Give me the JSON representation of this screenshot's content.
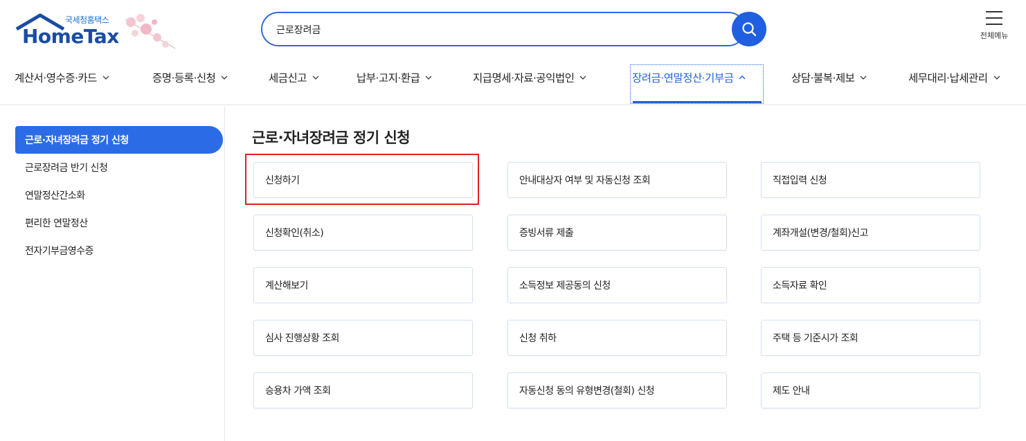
{
  "header": {
    "logo_sub": "국세청홈택스",
    "logo_main": "HomeTax",
    "search_value": "근로장려금",
    "all_menu_label": "전체메뉴"
  },
  "gnb": [
    {
      "label": "계산서·영수증·카드"
    },
    {
      "label": "증명·등록·신청"
    },
    {
      "label": "세금신고"
    },
    {
      "label": "납부·고지·환급"
    },
    {
      "label": "지급명세·자료·공익법인"
    },
    {
      "label": "장려금·연말정산·기부금"
    },
    {
      "label": "상담·불복·제보"
    },
    {
      "label": "세무대리·납세관리"
    }
  ],
  "sidebar": {
    "items": [
      {
        "label": "근로·자녀장려금 정기 신청"
      },
      {
        "label": "근로장려금 반기 신청"
      },
      {
        "label": "연말정산간소화"
      },
      {
        "label": "편리한 연말정산"
      },
      {
        "label": "전자기부금영수증"
      }
    ]
  },
  "main": {
    "title": "근로·자녀장려금 정기 신청",
    "cards": [
      {
        "label": "신청하기"
      },
      {
        "label": "안내대상자 여부 및 자동신청 조회"
      },
      {
        "label": "직접입력 신청"
      },
      {
        "label": "신청확인(취소)"
      },
      {
        "label": "증빙서류 제출"
      },
      {
        "label": "계좌개설(변경/철회)신고"
      },
      {
        "label": "계산해보기"
      },
      {
        "label": "소득정보 제공동의 신청"
      },
      {
        "label": "소득자료 확인"
      },
      {
        "label": "심사 진행상황 조회"
      },
      {
        "label": "신청 취하"
      },
      {
        "label": "주택 등 기준시가 조회"
      },
      {
        "label": "승용차 가액 조회"
      },
      {
        "label": "자동신청 동의 유형변경(철회) 신청"
      },
      {
        "label": "제도 안내"
      }
    ]
  },
  "colors": {
    "accent": "#1f5fe0",
    "sidebar_active": "#2b6ce6",
    "highlight": "#e02020"
  }
}
